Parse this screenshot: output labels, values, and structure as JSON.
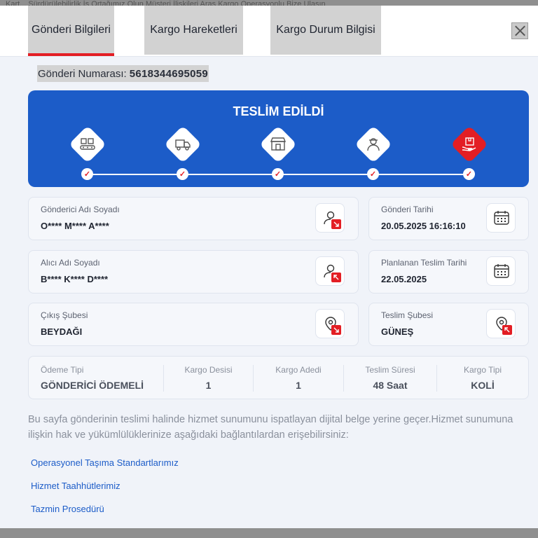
{
  "background": {
    "partial_text": "Kart... Sürdürülebilirlik İş Ortağımız Olun  Müşteri İlişkileri  Aras Kargo Operasyonlu  Bize Ulaşın"
  },
  "tabs": [
    {
      "label": "Gönderi Bilgileri",
      "active": true
    },
    {
      "label": "Kargo Hareketleri",
      "active": false
    },
    {
      "label": "Kargo Durum Bilgisi",
      "active": false
    }
  ],
  "shipment": {
    "number_label": "Gönderi Numarası:",
    "number_value": "5618344695059"
  },
  "status": {
    "title": "TESLİM EDİLDİ",
    "steps": [
      {
        "icon": "conveyor-boxes-icon",
        "done": true
      },
      {
        "icon": "delivery-truck-icon",
        "done": true
      },
      {
        "icon": "branch-store-icon",
        "done": true
      },
      {
        "icon": "courier-person-icon",
        "done": true
      },
      {
        "icon": "hand-package-icon",
        "done": true,
        "active": true
      }
    ]
  },
  "cards": {
    "sender": {
      "label": "Gönderici Adı Soyadı",
      "value": "O**** M**** A****"
    },
    "send_date": {
      "label": "Gönderi Tarihi",
      "value": "20.05.2025 16:16:10"
    },
    "receiver": {
      "label": "Alıcı Adı Soyadı",
      "value": "B**** K**** D****"
    },
    "planned_date": {
      "label": "Planlanan Teslim Tarihi",
      "value": "22.05.2025"
    },
    "origin_branch": {
      "label": "Çıkış Şubesi",
      "value": "BEYDAĞI"
    },
    "delivery_branch": {
      "label": "Teslim Şubesi",
      "value": "GÜNEŞ"
    }
  },
  "info": [
    {
      "label": "Ödeme Tipi",
      "value": "GÖNDERİCİ ÖDEMELİ"
    },
    {
      "label": "Kargo Desisi",
      "value": "1"
    },
    {
      "label": "Kargo Adedi",
      "value": "1"
    },
    {
      "label": "Teslim Süresi",
      "value": "48 Saat"
    },
    {
      "label": "Kargo Tipi",
      "value": "KOLİ"
    }
  ],
  "description": "Bu sayfa gönderinin teslimi halinde hizmet sunumunu ispatlayan dijital belge yerine geçer.Hizmet sunumuna ilişkin hak ve yükümlülüklerinize aşağıdaki bağlantılardan erişebilirsiniz:",
  "links": [
    "Operasyonel Taşıma Standartlarımız",
    "Hizmet Taahhütlerimiz",
    "Tazmin Prosedürü"
  ],
  "colors": {
    "accent_red": "#e31e24",
    "status_blue": "#1c5cc8"
  }
}
